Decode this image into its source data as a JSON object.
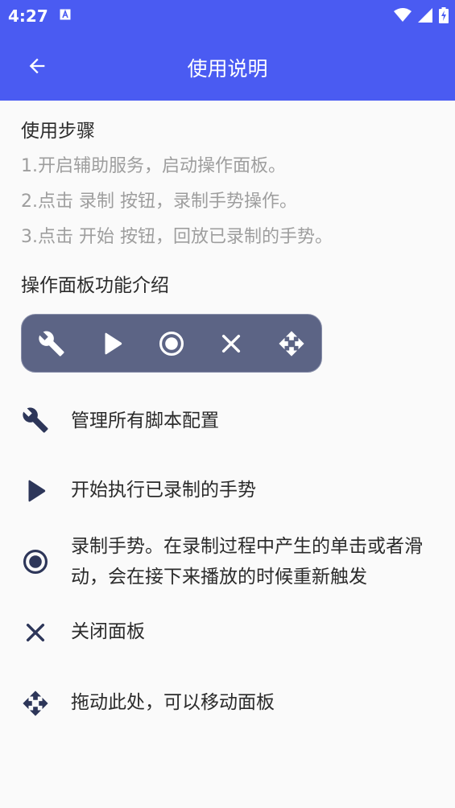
{
  "status_bar": {
    "time": "4:27",
    "notification_icon": "a-square-icon"
  },
  "app_bar": {
    "title": "使用说明",
    "back_icon": "arrow-left-icon"
  },
  "usage": {
    "title": "使用步骤",
    "steps": [
      "1.开启辅助服务，启动操作面板。",
      "2.点击 录制 按钮，录制手势操作。",
      "3.点击 开始 按钮，回放已录制的手势。"
    ]
  },
  "panel_intro": {
    "title": "操作面板功能介绍",
    "panel_icons": [
      "wrench-icon",
      "play-icon",
      "record-icon",
      "close-icon",
      "move-icon"
    ]
  },
  "features": [
    {
      "icon": "wrench-icon",
      "text": "管理所有脚本配置"
    },
    {
      "icon": "play-icon",
      "text": "开始执行已录制的手势"
    },
    {
      "icon": "record-icon",
      "text": "录制手势。在录制过程中产生的单击或者滑动，会在接下来播放的时候重新触发"
    },
    {
      "icon": "close-icon",
      "text": "关闭面板"
    },
    {
      "icon": "move-icon",
      "text": "拖动此处，可以移动面板"
    }
  ],
  "colors": {
    "primary": "#4a5bf2",
    "panel": "#5c6485",
    "icon": "#2d3659",
    "step_text": "#9e9e9e"
  }
}
